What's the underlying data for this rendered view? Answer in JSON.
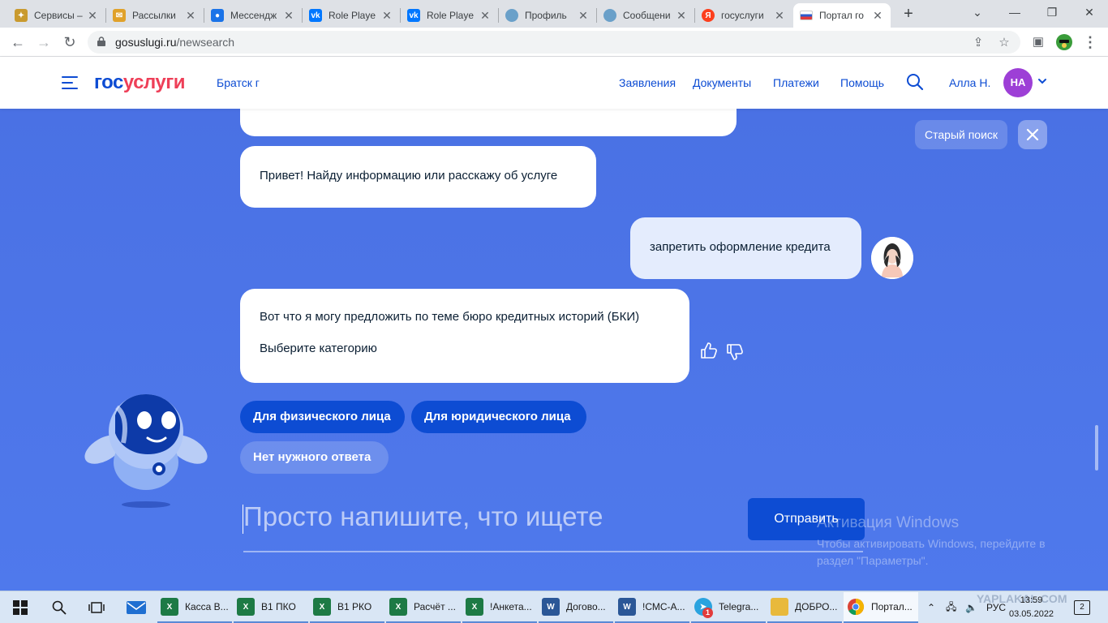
{
  "browser": {
    "tabs": [
      {
        "title": "Сервисы – ",
        "favicon": "emblem-icon",
        "color": "#c99a2e"
      },
      {
        "title": "Рассылки",
        "favicon": "mail-icon",
        "color": "#e0a12a"
      },
      {
        "title": "Мессендж",
        "favicon": "chat-icon",
        "color": "#1a73e8"
      },
      {
        "title": "Role Playe",
        "favicon": "vk-icon",
        "color": "#0077ff"
      },
      {
        "title": "Role Playe",
        "favicon": "vk-icon",
        "color": "#0077ff"
      },
      {
        "title": "Профиль",
        "favicon": "avatar-icon",
        "color": "#6aa0c9"
      },
      {
        "title": "Сообщени",
        "favicon": "avatar-icon",
        "color": "#6aa0c9"
      },
      {
        "title": "госуслуги",
        "favicon": "yandex-icon",
        "color": "#fc3f1d"
      },
      {
        "title": "Портал го",
        "favicon": "russia-flag-icon",
        "color": "#2b5bcc",
        "active": true
      }
    ],
    "url_host": "gosuslugi.ru",
    "url_path": "/newsearch"
  },
  "header": {
    "logo_part1": "гос",
    "logo_part2": "услуги",
    "city": "Братск г",
    "nav": [
      "Заявления",
      "Документы",
      "Платежи",
      "Помощь"
    ],
    "user_name": "Алла Н.",
    "avatar_initials": "НА"
  },
  "chat": {
    "old_search_label": "Старый поиск",
    "bot_greeting": "Привет! Найду информацию или расскажу об услуге",
    "user_message": "запретить оформление кредита",
    "bot_reply_line1": "Вот что я могу предложить по теме бюро кредитных историй (БКИ)",
    "bot_reply_line2": "Выберите категорию",
    "options": [
      "Для физического лица",
      "Для юридического лица",
      "Нет нужного ответа"
    ],
    "input_placeholder": "Просто напишите, что ищете",
    "send_label": "Отправить"
  },
  "activation": {
    "title": "Активация Windows",
    "text_line1": "Чтобы активировать Windows, перейдите в",
    "text_line2": "раздел \"Параметры\"."
  },
  "taskbar": {
    "apps": [
      {
        "label": "Касса В...",
        "icon": "excel-icon",
        "color": "#1d7a45"
      },
      {
        "label": "В1 ПКО",
        "icon": "excel-icon",
        "color": "#1d7a45"
      },
      {
        "label": "В1 РКО",
        "icon": "excel-icon",
        "color": "#1d7a45"
      },
      {
        "label": "Расчёт ...",
        "icon": "excel-icon",
        "color": "#1d7a45"
      },
      {
        "label": "!Анкета...",
        "icon": "excel-icon",
        "color": "#1d7a45"
      },
      {
        "label": "Догово...",
        "icon": "word-icon",
        "color": "#2b5797"
      },
      {
        "label": "!СМС-А...",
        "icon": "word-icon",
        "color": "#2b5797"
      },
      {
        "label": "Telegra...",
        "icon": "telegram-icon",
        "color": "#2aa3df",
        "badge": "1"
      },
      {
        "label": "ДОБРО...",
        "icon": "folder-icon",
        "color": "#e8b93c"
      },
      {
        "label": "Портал...",
        "icon": "chrome-icon",
        "color": "#db4437",
        "active": true
      }
    ],
    "lang": "РУС",
    "time": "13:59",
    "date": "03.05.2022",
    "notifications": "2",
    "watermark": "YAPLAKAL.COM"
  }
}
